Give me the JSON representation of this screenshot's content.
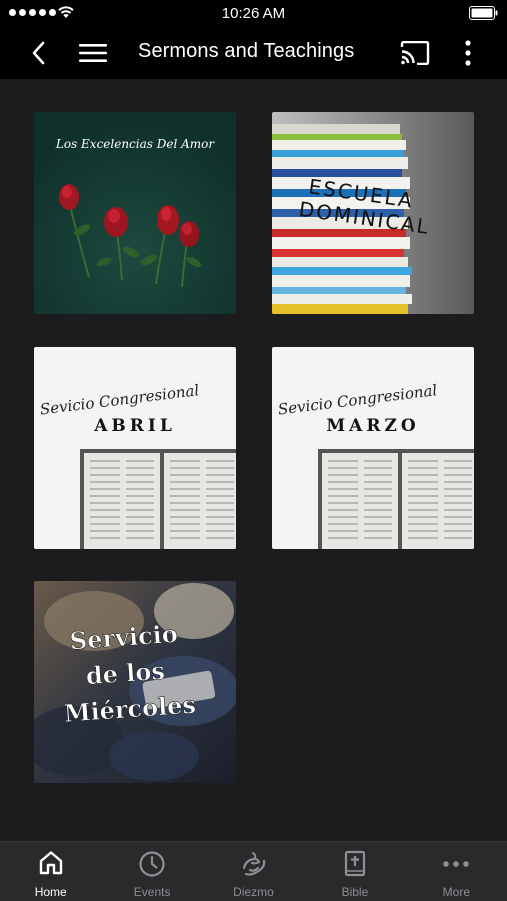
{
  "status_bar": {
    "time": "10:26 AM"
  },
  "header": {
    "title": "Sermons and Teachings"
  },
  "tiles": [
    {
      "title": "Los Excelencias Del Amor"
    },
    {
      "line1": "ESCUELA",
      "line2": "DOMINICAL"
    },
    {
      "title": "Sevicio Congresional",
      "subtitle": "ABRIL"
    },
    {
      "title": "Sevicio Congresional",
      "subtitle": "MARZO"
    },
    {
      "line1": "Servicio",
      "line2": "de los",
      "line3": "Miércoles"
    }
  ],
  "tab_bar": {
    "items": [
      {
        "label": "Home",
        "icon": "home-icon"
      },
      {
        "label": "Events",
        "icon": "clock-icon"
      },
      {
        "label": "Diezmo",
        "icon": "tithe-icon"
      },
      {
        "label": "Bible",
        "icon": "bible-icon"
      },
      {
        "label": "More",
        "icon": "more-dots-icon"
      }
    ]
  }
}
